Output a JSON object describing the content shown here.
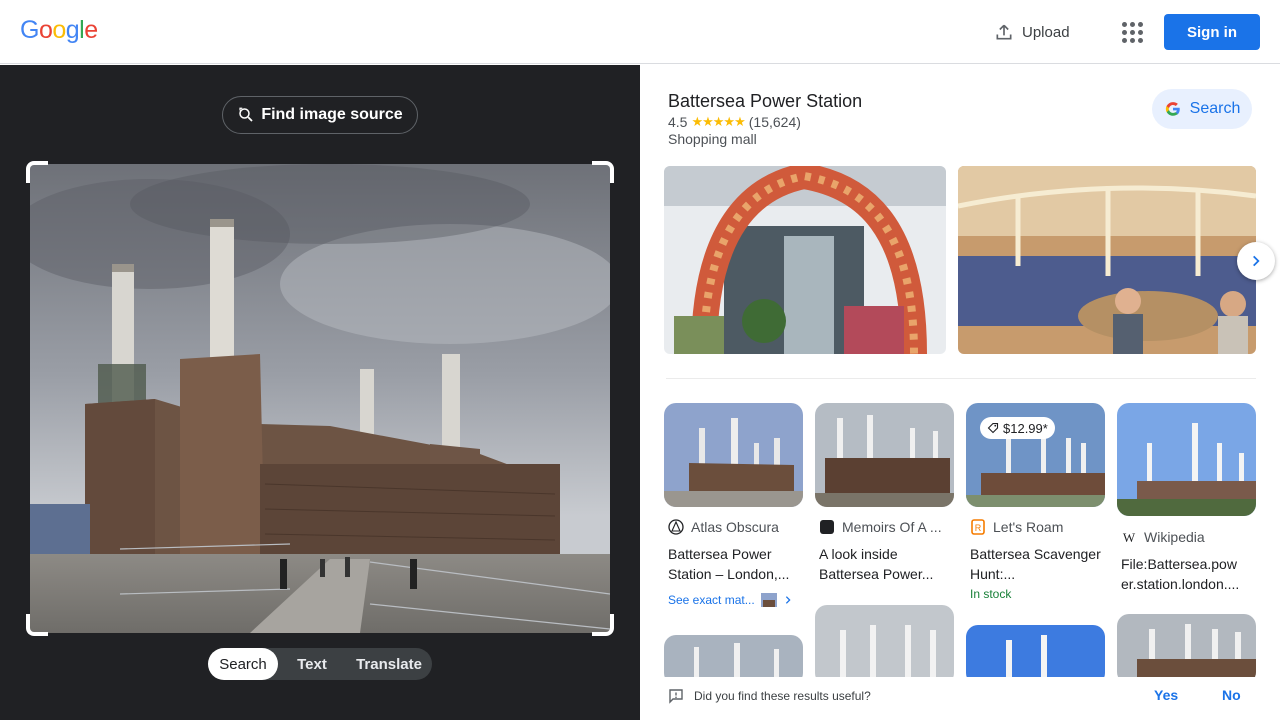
{
  "header": {
    "logo_letters": [
      "G",
      "o",
      "o",
      "g",
      "l",
      "e"
    ],
    "logo_colors": [
      "#4285f4",
      "#ea4335",
      "#fbbc05",
      "#4285f4",
      "#34a853",
      "#ea4335"
    ],
    "upload_label": "Upload",
    "signin_label": "Sign in",
    "icons": {
      "upload": "upload-icon",
      "apps": "apps-grid-icon"
    }
  },
  "left": {
    "find_source_label": "Find image source",
    "modes": [
      {
        "label": "Search",
        "active": true
      },
      {
        "label": "Text",
        "active": false
      },
      {
        "label": "Translate",
        "active": false
      }
    ]
  },
  "knowledge": {
    "title": "Battersea Power Station",
    "rating": "4.5",
    "stars": "★★★★★",
    "star_fraction": 0.5,
    "reviews": "(15,624)",
    "type": "Shopping mall",
    "search_label": "Search"
  },
  "results": [
    {
      "source": "Atlas Obscura",
      "title": "Battersea Power Station – London,...",
      "exact_label": "See exact mat...",
      "stock": ""
    },
    {
      "source": "Memoirs Of A ...",
      "title": "A look inside Battersea Power...",
      "exact_label": "",
      "stock": ""
    },
    {
      "source": "Let's Roam",
      "title": "Battersea Scavenger Hunt:...",
      "exact_label": "",
      "stock": "In stock",
      "price": "$12.99*"
    },
    {
      "source": "Wikipedia",
      "title": "File:Battersea.pow er.station.london....",
      "exact_label": "",
      "stock": ""
    }
  ],
  "feedback": {
    "question": "Did you find these results useful?",
    "yes": "Yes",
    "no": "No"
  },
  "colors": {
    "accent": "#1a73e8",
    "dark_panel": "#202124",
    "star": "#fbbc04",
    "stock_green": "#188038"
  }
}
